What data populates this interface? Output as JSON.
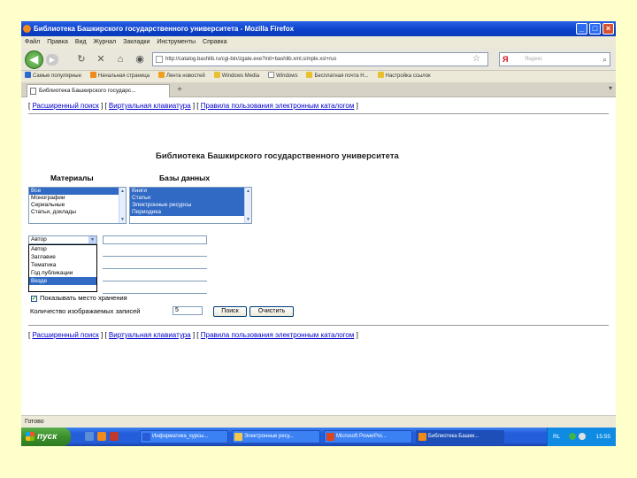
{
  "window": {
    "title": "Библиотека Башкирского государственного университета - Mozilla Firefox"
  },
  "menu": [
    "Файл",
    "Правка",
    "Вид",
    "Журнал",
    "Закладки",
    "Инструменты",
    "Справка"
  ],
  "address": {
    "url": "http://catalog.bashlib.ru/cgi-bin/zgate.exe?init+bashlib.xml,simple.xsl+rus"
  },
  "search": {
    "engine_icon": "Я",
    "placeholder": "Яндекс"
  },
  "bookmarks": [
    "Самые популярные",
    "Начальная страница",
    "Лента новостей",
    "Windows Media",
    "Windows",
    "Бесплатная почта H...",
    "Настройка ссылок"
  ],
  "tab": {
    "title": "Библиотека Башкирского государс..."
  },
  "links": {
    "advanced": "Расширенный поиск",
    "keyboard": "Виртуальная клавиатура",
    "rules": "Правила пользования электронным каталогом"
  },
  "page": {
    "heading": "Библиотека Башкирского государственного университета"
  },
  "materials": {
    "label": "Материалы",
    "options": [
      "Все",
      "Монографии",
      "Сериальные",
      "Статьи, доклады"
    ],
    "selected_index": 0
  },
  "databases": {
    "label": "Базы данных",
    "options": [
      "Книги",
      "Статьи",
      "Электронные ресурсы",
      "Периодика"
    ]
  },
  "field_select": {
    "value": "Автор",
    "options": [
      "Автор",
      "Заглавие",
      "Тематика",
      "Год публикации",
      "Везде"
    ],
    "highlighted_index": 4
  },
  "options": {
    "show_location_label": "Показывать место хранения",
    "show_location_checked": true,
    "count_label": "Количество изображаемых записей",
    "count_value": "5"
  },
  "buttons": {
    "search": "Поиск",
    "reset": "Очистить"
  },
  "status": {
    "text": "Готово"
  },
  "taskbar": {
    "start": "пуск",
    "tasks": [
      {
        "label": "Информатика_курсы...",
        "color": "#2a5ad8"
      },
      {
        "label": "Электронные ресу...",
        "color": "#f2c94c"
      },
      {
        "label": "Microsoft PowerPoi...",
        "color": "#d9461f"
      },
      {
        "label": "Библиотека Башки...",
        "color": "#f08a1c"
      }
    ],
    "lang": "RL",
    "clock": "15:55"
  }
}
